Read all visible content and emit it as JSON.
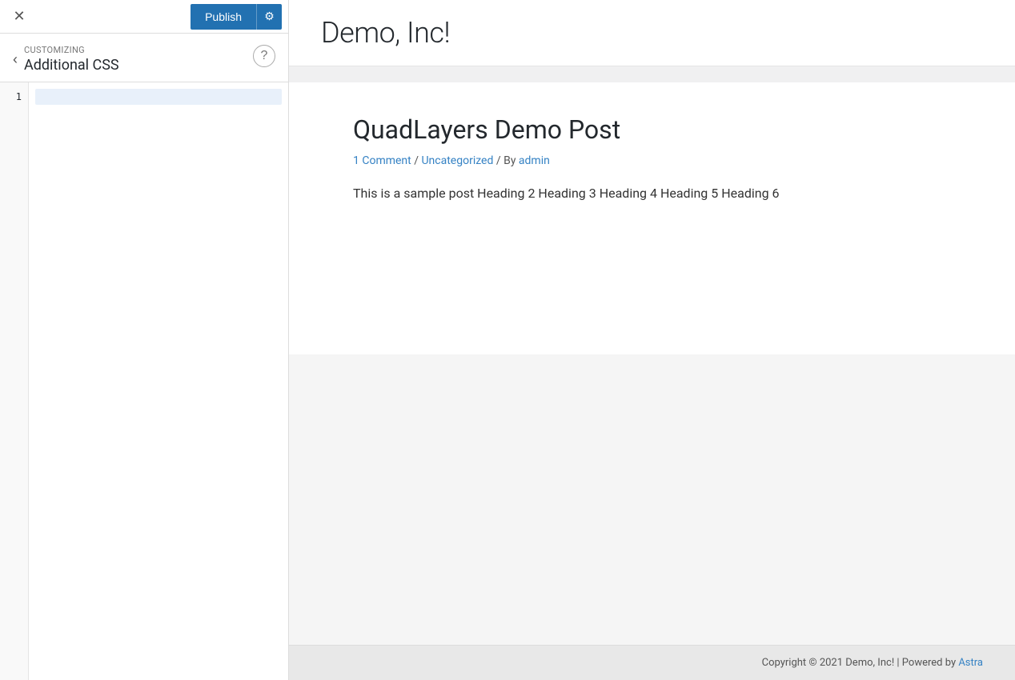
{
  "topbar": {
    "close_label": "✕",
    "publish_label": "Publish",
    "settings_icon": "⚙"
  },
  "customizer": {
    "customizing_label": "Customizing",
    "section_title": "Additional CSS",
    "back_icon": "‹",
    "help_icon": "?"
  },
  "code_editor": {
    "line_numbers": [
      "1"
    ]
  },
  "preview": {
    "site_title": "Demo, Inc!",
    "post": {
      "title": "QuadLayers Demo Post",
      "meta_comment": "1 Comment",
      "meta_separator1": " / ",
      "meta_category": "Uncategorized",
      "meta_separator2": " / By ",
      "meta_author": "admin",
      "excerpt": "This is a sample post Heading 2 Heading 3 Heading 4 Heading 5 Heading 6"
    },
    "footer": {
      "copyright": "Copyright © 2021 Demo, Inc! | Powered by ",
      "powered_by_link": "Astra"
    }
  }
}
